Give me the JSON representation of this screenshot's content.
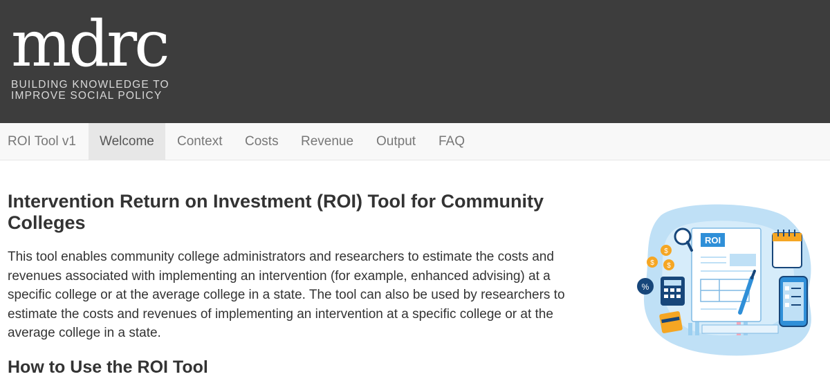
{
  "header": {
    "logo_text": "mdrc",
    "tagline_line1": "BUILDING KNOWLEDGE TO",
    "tagline_line2": "IMPROVE SOCIAL POLICY"
  },
  "nav": {
    "brand": "ROI Tool v1",
    "tabs": [
      {
        "label": "Welcome",
        "active": true
      },
      {
        "label": "Context",
        "active": false
      },
      {
        "label": "Costs",
        "active": false
      },
      {
        "label": "Revenue",
        "active": false
      },
      {
        "label": "Output",
        "active": false
      },
      {
        "label": "FAQ",
        "active": false
      }
    ]
  },
  "main": {
    "title": "Intervention Return on Investment (ROI) Tool for Community Colleges",
    "intro": "This tool enables community college administrators and researchers to estimate the costs and revenues associated with implementing an intervention (for example, enhanced advising) at a specific college or at the average college in a state. The tool can also be used by researchers to estimate the costs and revenues of implementing an intervention at a specific college or at the average college in a state.",
    "section_heading": "How to Use the ROI Tool"
  },
  "illustration": {
    "roi_label": "ROI",
    "percent_label": "%",
    "dollar_glyph": "$",
    "icons": [
      "magnifier-icon",
      "calendar-icon",
      "calculator-icon",
      "phone-checklist-icon",
      "pen-icon",
      "credit-card-icon",
      "coin-icon"
    ]
  },
  "colors": {
    "banner_bg": "#3d3d3d",
    "navbar_bg": "#f8f8f8",
    "active_tab_bg": "#e7e7e7",
    "illustration_blue": "#4a9fd8",
    "illustration_light_blue": "#bfe0f6"
  }
}
